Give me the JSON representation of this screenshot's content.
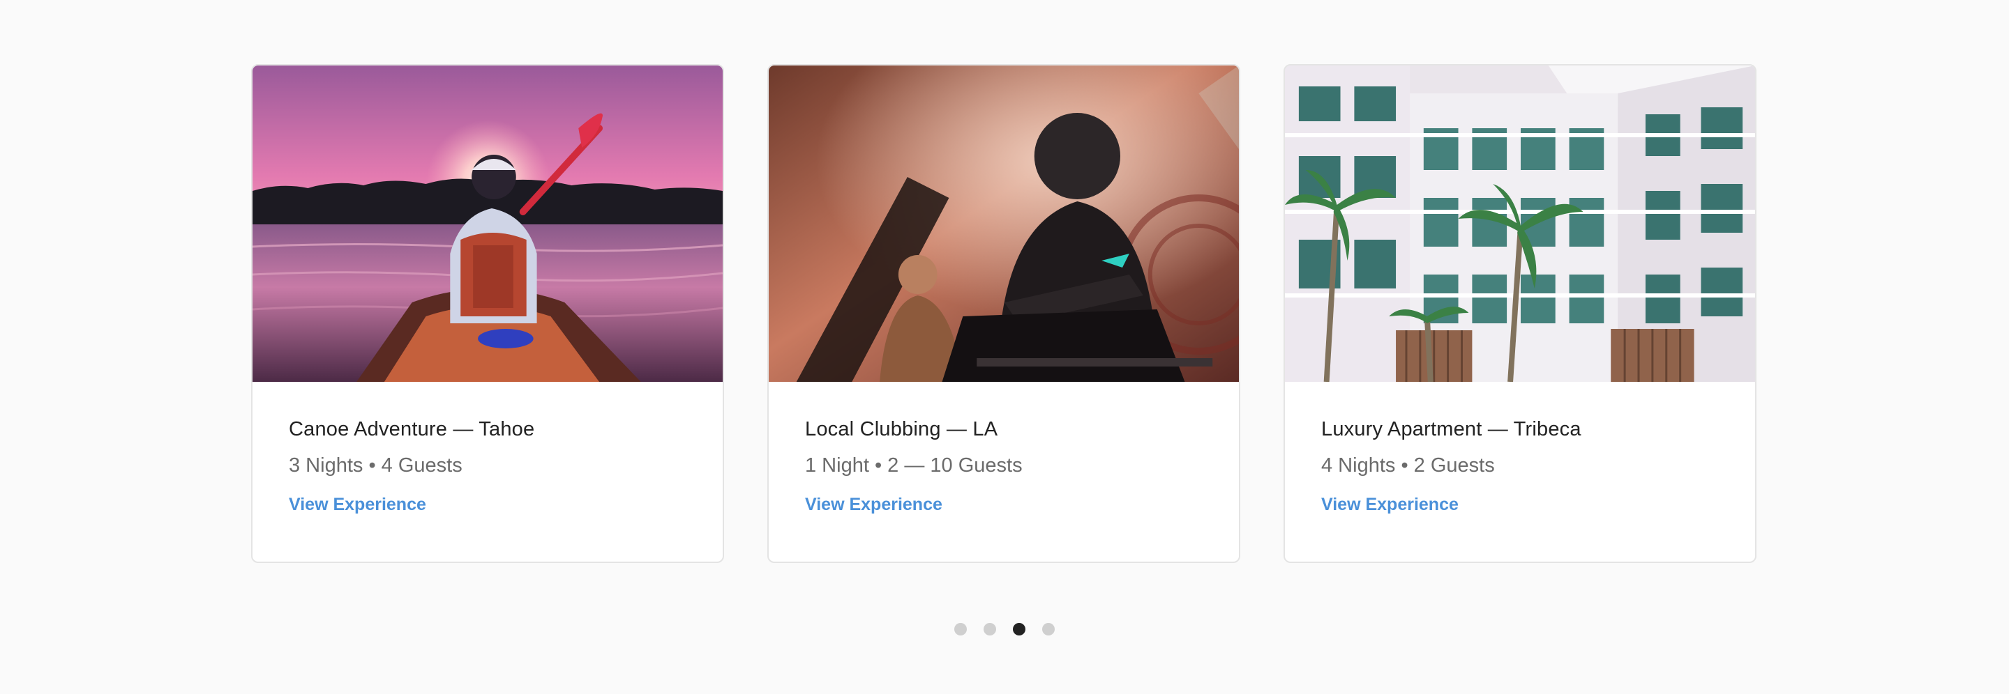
{
  "carousel": {
    "cards": [
      {
        "title": "Canoe Adventure — Tahoe",
        "meta": "3 Nights • 4 Guests",
        "link_label": "View Experience"
      },
      {
        "title": "Local Clubbing — LA",
        "meta": "1 Night • 2 — 10 Guests",
        "link_label": "View Experience"
      },
      {
        "title": "Luxury Apartment — Tribeca",
        "meta": "4 Nights • 2 Guests",
        "link_label": "View Experience"
      }
    ],
    "pager": {
      "count": 4,
      "active_index": 2
    }
  },
  "colors": {
    "background": "#fafafa",
    "card_background": "#ffffff",
    "title": "#222222",
    "meta": "#6b6b6b",
    "link": "#4a90d9",
    "dot_inactive": "#cfcfcf",
    "dot_active": "#222222"
  }
}
